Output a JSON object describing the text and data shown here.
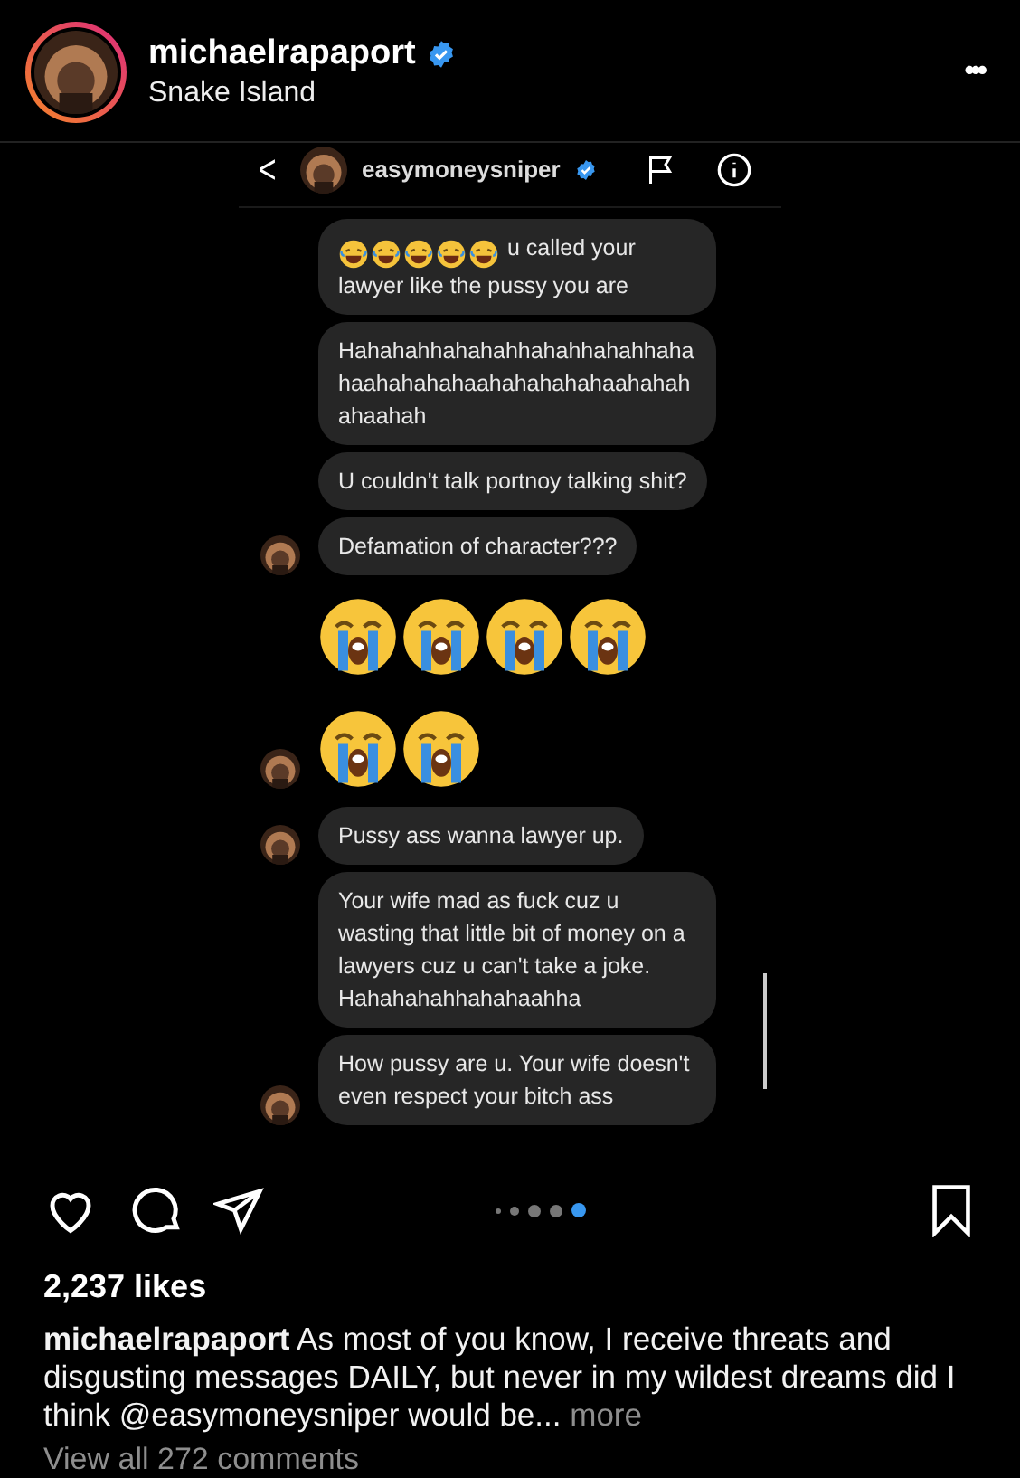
{
  "post_header": {
    "username": "michaelrapaport",
    "verified": true,
    "location": "Snake Island",
    "more": "•••"
  },
  "dm": {
    "back": "<",
    "username": "easymoneysniper",
    "verified": true,
    "messages": [
      {
        "kind": "text",
        "avatar": false,
        "emojis": [
          {
            "kind": "laughing"
          },
          {
            "kind": "laughing"
          },
          {
            "kind": "laughing"
          },
          {
            "kind": "laughing"
          },
          {
            "kind": "laughing"
          }
        ],
        "text": "u called your lawyer like  the pussy you are"
      },
      {
        "kind": "text",
        "avatar": false,
        "text": "Hahahahhahahahhahahhahahhaha haahahahahaahahahahahaahahah ahaahah"
      },
      {
        "kind": "text",
        "avatar": false,
        "text": "U couldn't talk portnoy talking shit?"
      },
      {
        "kind": "text",
        "avatar": true,
        "text": "Defamation of character???"
      },
      {
        "kind": "emoji_row",
        "avatar": false,
        "emojis": [
          {
            "kind": "crying"
          },
          {
            "kind": "crying"
          },
          {
            "kind": "crying"
          },
          {
            "kind": "crying"
          }
        ]
      },
      {
        "kind": "emoji_row",
        "avatar": true,
        "emojis": [
          {
            "kind": "crying"
          },
          {
            "kind": "crying"
          }
        ]
      },
      {
        "kind": "text",
        "avatar": true,
        "text": "Pussy ass wanna lawyer up."
      },
      {
        "kind": "text",
        "avatar": false,
        "text": "Your wife mad as fuck cuz u wasting that little bit of money on a lawyers cuz u can't take a joke. Hahahahahhahahaahha"
      },
      {
        "kind": "text",
        "avatar": true,
        "text": "How pussy are u. Your wife doesn't even respect your bitch ass"
      }
    ]
  },
  "carousel_dots": [
    {
      "selected": false
    },
    {
      "selected": false
    },
    {
      "selected": false
    },
    {
      "selected": false
    },
    {
      "selected": true
    }
  ],
  "likes": "2,237 likes",
  "caption": {
    "text": "**michaelrapaport** As most of you know, I receive threats and disgusting messages DAILY, but never in my wildest dreams did I think @easymoneysniper would be...",
    "more": "more"
  },
  "comments_link": "View all 272 comments"
}
